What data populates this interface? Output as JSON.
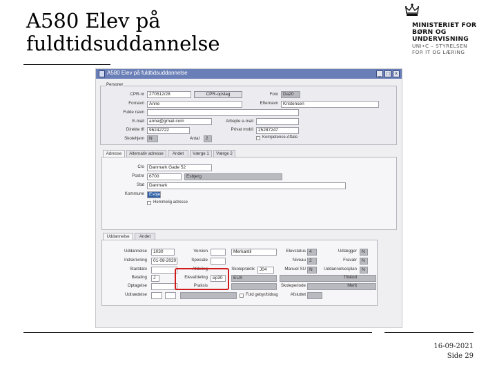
{
  "slide": {
    "title": "A580 Elev på fuldtidsuddannelse",
    "date": "16-09-2021",
    "page": "Side 29"
  },
  "logo": {
    "lines": [
      "MINISTERIET FOR",
      "BØRN OG",
      "UNDERVISNING"
    ],
    "sublines": [
      "UNI•C – STYRELSEN",
      "FOR IT OG LÆRING"
    ]
  },
  "window": {
    "title": "A580 Elev på fuldtidsuddannelse",
    "minimize_label": "_",
    "maximize_label": "□",
    "close_label": "×"
  },
  "person": {
    "group_title": "Personer",
    "cpr_label": "CPR-nr",
    "cpr_value": "270512/28",
    "cpr_button": "CPR-opslag",
    "photo_label": "Foto",
    "photo_value": "Da20",
    "fornavn_label": "Fornavn",
    "fornavn_value": "Anne",
    "efternavn_label": "Efternavn",
    "efternavn_value": "Kristensen",
    "fulde_navn_label": "Fulde navn",
    "email_label": "E-mail",
    "email_value": "anne@gmail.com",
    "arbejde_email_label": "Arbejde e-mail",
    "direkte_tlf_label": "Direkte tlf",
    "direkte_tlf_value": "96242722",
    "privat_mobil_label": "Privat mobil",
    "privat_mobil_value": "25287247",
    "skolehjem_label": "Skolehjem",
    "skolehjem_value": "N",
    "antal_label": "Antal",
    "antal_value": "2",
    "kompetence_label": "Kompetence-Aftale"
  },
  "address_tabs": [
    "Adresse",
    "Alternativ adresse",
    "Andet",
    "Værge 1",
    "Værge 2"
  ],
  "address": {
    "co_label": "C/o",
    "co_value": "Danmark Gade 52",
    "postnr_label": "Postnr",
    "postnr_value": "6700",
    "by_value": "Esbjerg",
    "stat_label": "Stat",
    "stat_value": "Danmark",
    "kommune_label": "Kommune",
    "kommune_value": "Esbjerg",
    "beskyttet_label": "Hemmelig adresse"
  },
  "edu_tabs": [
    "Uddannelse",
    "Andet"
  ],
  "education": {
    "uddannelse_label": "Uddannelse",
    "uddannelse_value": "1030",
    "version_label": "Version",
    "speciale_label": "Speciale",
    "speciale_value": "Merkantil",
    "elevstatus_label": "Elevstatus",
    "elevstatus_value": "4",
    "udlaegger_label": "Udlægger",
    "udlaegger_value": "N",
    "indskrivning_label": "Indskrivning",
    "indskrivning_value": "01-08-2020",
    "speciale2_label": "Speciale",
    "niveau_label": "Niveau",
    "niveau_value": "2",
    "fravaer_label": "Fravær",
    "fravaer_value": "N",
    "startdato_label": "Startdato",
    "afdeling_label": "Afdeling",
    "skolepraktik_label": "Skolepraktik",
    "skolepraktik_value": "J04",
    "manuel_label": "Manuel SU",
    "manuel_value": "N",
    "uddannelsesplan_label": "Uddannelsesplan",
    "uddannelsesplan_value": "N",
    "betaling_label": "Betaling",
    "betaling_value": "J",
    "elevafdeling_label": "Elevafdeling",
    "elevafdeling_value": "ep30",
    "elevafdeling_text": "EUX",
    "tilskud_label": "Tilskud",
    "optagelse_label": "Optagelse",
    "praksis_label": "Praksis",
    "skoleperiode_label": "Skoleperiode",
    "merit_label": "Merit",
    "udtraedelse_label": "Udtrædelse",
    "afsluttet_label": "Afsluttet",
    "fuld_gebyr_label": "Fuld gebyr/bidrag"
  }
}
